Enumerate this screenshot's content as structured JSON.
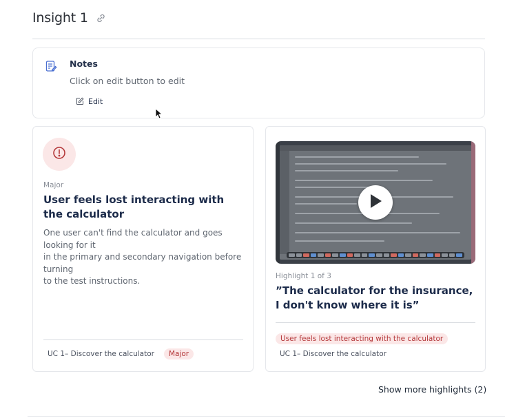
{
  "insight": {
    "title": "Insight 1",
    "link_icon": "link-icon"
  },
  "notes": {
    "icon": "notes-icon",
    "title": "Notes",
    "hint": "Click on edit button to edit",
    "edit_label": "Edit",
    "edit_icon": "edit-icon"
  },
  "insight_card": {
    "icon": "alert-circle-icon",
    "severity": "Major",
    "title": "User feels lost interacting with the calculator",
    "description": "One user can't find the calculator and goes looking for it\nin the primary and secondary navigation before turning\nto the test instructions.",
    "tags": [
      "UC 1– Discover the calculator",
      "Major"
    ]
  },
  "highlight_card": {
    "video_icon": "play-icon",
    "count_text": "Highlight 1 of 3",
    "quote": "”The calculator for the insurance, I don't know where it is”",
    "tags": [
      "User feels lost interacting with the calculator",
      "UC 1– Discover the calculator"
    ]
  },
  "footer": {
    "show_more": "Show more highlights (2)"
  },
  "colors": {
    "accent_red": "#b4383a",
    "red_tint": "#fbe7e7",
    "heading_navy": "#1c2b4a"
  }
}
